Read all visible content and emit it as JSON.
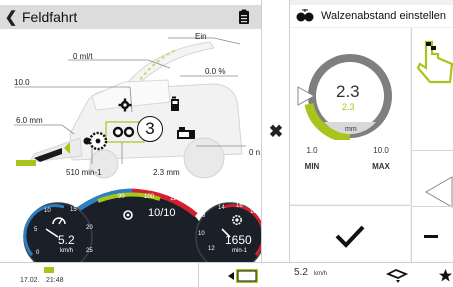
{
  "header": {
    "title": "Feldfahrt"
  },
  "machine": {
    "ein_label": "Ein",
    "throughput": "0 ml/t",
    "percent": "0.0 %",
    "val_left": "10.0",
    "val_cut": "6.0 mm",
    "speed_left": "510 min-1",
    "length": "2.3 mm",
    "right_edge": "0 n",
    "active_number": "3"
  },
  "dashboard": {
    "ground_speed": "5.2",
    "ground_speed_unit": "km/h",
    "gear": "10/10",
    "engine_rpm": "1650",
    "engine_rpm_unit": "min-1",
    "left_ticks": [
      "0",
      "5",
      "10",
      "15",
      "20",
      "25"
    ],
    "center_ticks": [
      "90",
      "100",
      "110"
    ],
    "right_ticks": [
      "8",
      "10",
      "12",
      "14",
      "16",
      "18"
    ]
  },
  "right_panel": {
    "title": "Walzenabstand einstellen",
    "dial_value": "2.3",
    "dial_set_value": "2.3",
    "dial_unit": "mm",
    "min_value": "1.0",
    "min_label": "MIN",
    "max_value": "10.0",
    "max_label": "MAX"
  },
  "status_bar": {
    "date": "17.02.",
    "time": "21:48",
    "speed": "5.2",
    "speed_unit": "km/h"
  },
  "colors": {
    "accent_green": "#a8c51c",
    "dash_blue": "#2d7fc4",
    "dash_red": "#d2202f",
    "dash_dark": "#1b1f27"
  }
}
